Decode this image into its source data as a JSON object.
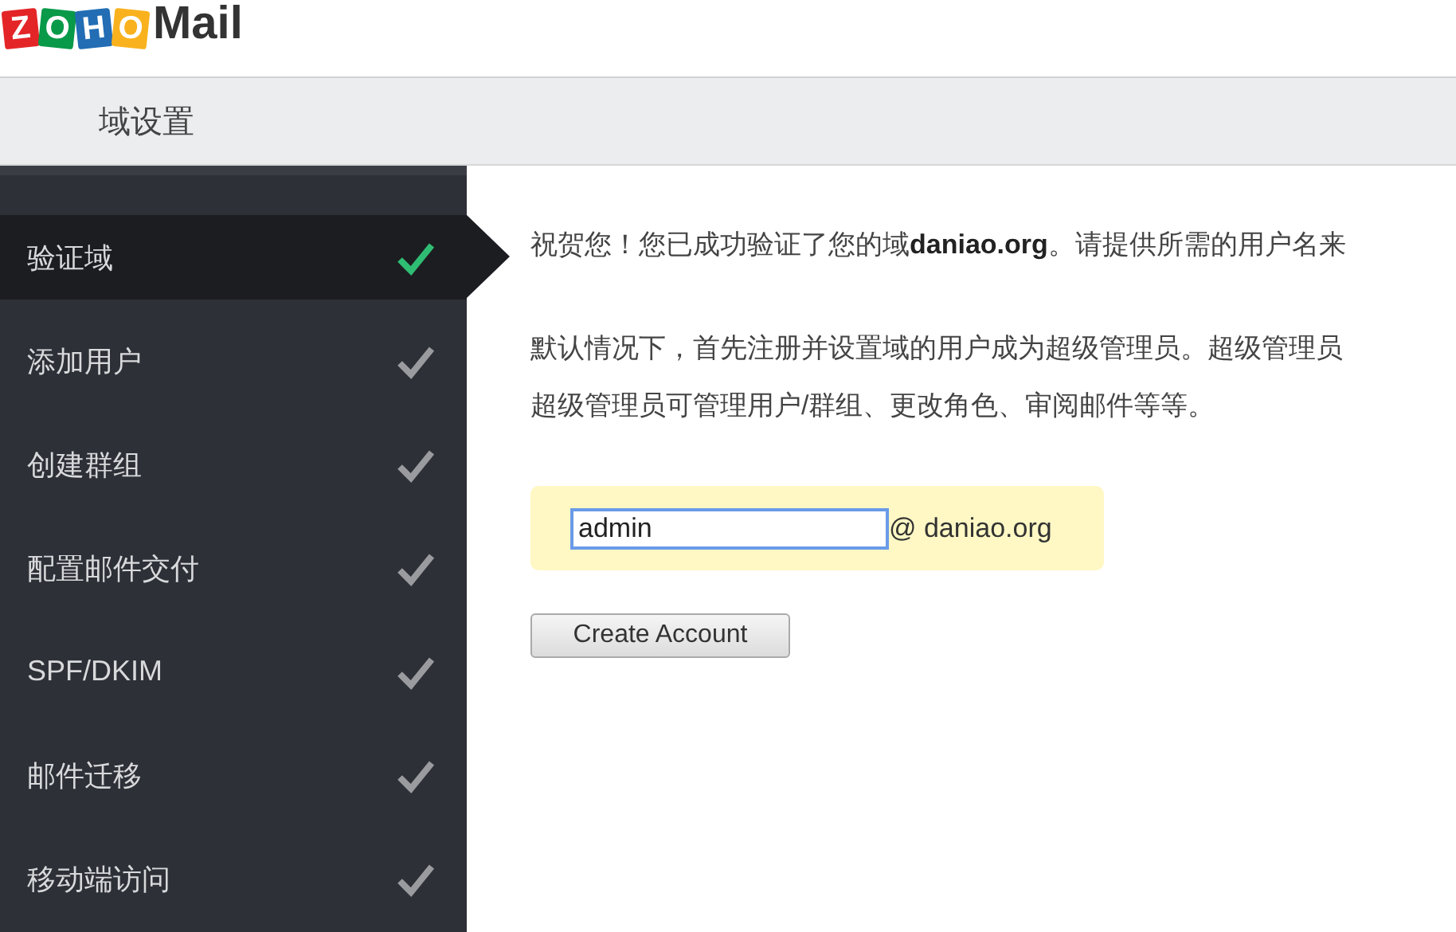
{
  "logo": {
    "tiles": [
      {
        "letter": "Z",
        "color": "#e42527"
      },
      {
        "letter": "O",
        "color": "#089949"
      },
      {
        "letter": "H",
        "color": "#226db4"
      },
      {
        "letter": "O",
        "color": "#f9b21d"
      }
    ],
    "text": "Mail"
  },
  "page_title": "域设置",
  "sidebar": {
    "items": [
      {
        "label": "验证域",
        "selected": true,
        "done": true
      },
      {
        "label": "添加用户",
        "selected": false,
        "done": false
      },
      {
        "label": "创建群组",
        "selected": false,
        "done": false
      },
      {
        "label": "配置邮件交付",
        "selected": false,
        "done": false
      },
      {
        "label": "SPF/DKIM",
        "selected": false,
        "done": false
      },
      {
        "label": "邮件迁移",
        "selected": false,
        "done": false
      },
      {
        "label": "移动端访问",
        "selected": false,
        "done": false
      }
    ]
  },
  "content": {
    "paragraphs": [
      "祝贺您！您已成功验证了您的域**daniao.org**。请提供所需的用户名来",
      "默认情况下，首先注册并设置域的用户成为超级管理员。超级管理员",
      "超级管理员可管理用户/群组、更改角色、审阅邮件等等。"
    ],
    "username": {
      "value": "admin",
      "suffix": "@ daniao.org"
    },
    "button": "Create Account"
  }
}
